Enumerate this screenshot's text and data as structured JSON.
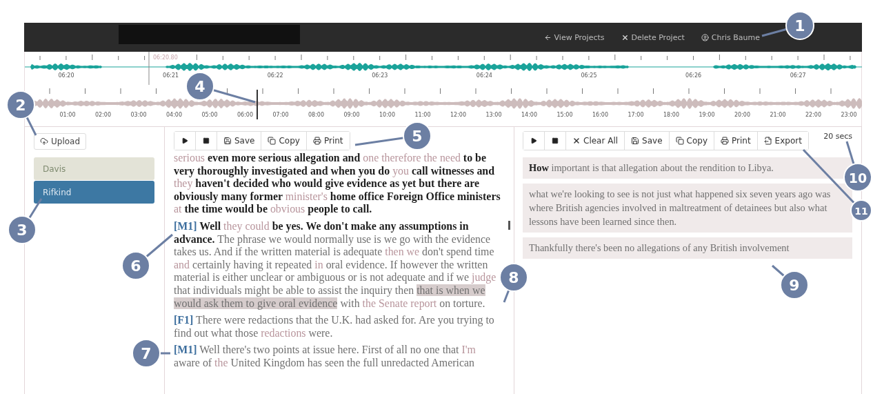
{
  "header": {
    "nav": [
      {
        "kind": "back",
        "label": "View Projects"
      },
      {
        "kind": "delete",
        "label": "Delete Project"
      },
      {
        "kind": "user",
        "label": "Chris Baume"
      }
    ]
  },
  "overview": {
    "cursor_time": "06:20.80",
    "ticks": [
      "06:20",
      "06:21",
      "06:22",
      "06:23",
      "06:24",
      "06:25",
      "06:26",
      "06:27"
    ]
  },
  "timeline": {
    "ticks": [
      "01:00",
      "02:00",
      "03:00",
      "04:00",
      "05:00",
      "06:00",
      "07:00",
      "08:00",
      "09:00",
      "10:00",
      "11:00",
      "12:00",
      "13:00",
      "14:00",
      "15:00",
      "16:00",
      "17:00",
      "18:00",
      "19:00",
      "20:00",
      "21:00",
      "22:00",
      "23:00"
    ]
  },
  "upload": {
    "label": "Upload"
  },
  "speakers": [
    {
      "name": "Davis",
      "selected": false
    },
    {
      "name": "Rifkind",
      "selected": true
    }
  ],
  "transcript": {
    "toolbar": [
      {
        "kind": "play"
      },
      {
        "kind": "stop"
      },
      {
        "kind": "save",
        "label": "Save"
      },
      {
        "kind": "copy",
        "label": "Copy"
      },
      {
        "kind": "print",
        "label": "Print"
      }
    ],
    "paragraphs": [
      {
        "segments": [
          {
            "kind": "faint",
            "text": "serious"
          },
          {
            "kind": "played",
            "text": " even more serious allegation and "
          },
          {
            "kind": "faint",
            "text": "one therefore the need"
          },
          {
            "kind": "played",
            "text": " to be very thoroughly investigated and when you do "
          },
          {
            "kind": "faint",
            "text": "you"
          },
          {
            "kind": "played",
            "text": " call witnesses and "
          },
          {
            "kind": "faint",
            "text": "they"
          },
          {
            "kind": "played",
            "text": " haven't decided who would give evidence as yet but there are obviously many former "
          },
          {
            "kind": "faint",
            "text": "minister's"
          },
          {
            "kind": "played",
            "text": " home office Foreign Office ministers "
          },
          {
            "kind": "faint",
            "text": "at"
          },
          {
            "kind": "played",
            "text": " the time would be "
          },
          {
            "kind": "faint",
            "text": "obvious"
          },
          {
            "kind": "played",
            "text": " people to call."
          }
        ]
      },
      {
        "speaker": "[M1]",
        "segments": [
          {
            "kind": "played",
            "text": " Well "
          },
          {
            "kind": "faint",
            "text": "they could"
          },
          {
            "kind": "played",
            "text": " be yes. We don't make any assumptions in advance."
          },
          {
            "kind": "unplayed",
            "text": " The phrase we would normally use is we go with the evidence takes us. And if the written material is adequate "
          },
          {
            "kind": "faint",
            "text": "then we"
          },
          {
            "kind": "unplayed",
            "text": " don't spend time "
          },
          {
            "kind": "faint",
            "text": "and"
          },
          {
            "kind": "unplayed",
            "text": " certainly having it repeated "
          },
          {
            "kind": "faint",
            "text": "in"
          },
          {
            "kind": "unplayed",
            "text": " oral evidence. If however the written material is either unclear or ambiguous or is not adequate and if we "
          },
          {
            "kind": "faint",
            "text": "judge"
          },
          {
            "kind": "unplayed",
            "text": " that individuals might be able to assist the inquiry then "
          },
          {
            "kind": "selected",
            "text": "that is when we would ask them to give oral evidence"
          },
          {
            "kind": "unplayed",
            "text": " with "
          },
          {
            "kind": "faint",
            "text": "the Senate report"
          },
          {
            "kind": "unplayed",
            "text": " on torture."
          }
        ]
      },
      {
        "speaker": "[F1]",
        "segments": [
          {
            "kind": "unplayed",
            "text": " There were redactions that the U.K. had asked for. Are you trying to find out what those "
          },
          {
            "kind": "faint",
            "text": "redactions"
          },
          {
            "kind": "unplayed",
            "text": " were."
          }
        ]
      },
      {
        "speaker": "[M1]",
        "segments": [
          {
            "kind": "unplayed",
            "text": " Well there's two points at issue here. First of all no one that "
          },
          {
            "kind": "faint",
            "text": "I'm"
          },
          {
            "kind": "unplayed",
            "text": " aware of "
          },
          {
            "kind": "faint",
            "text": "the"
          },
          {
            "kind": "unplayed",
            "text": " United Kingdom has seen the full unredacted American"
          }
        ]
      }
    ]
  },
  "clips": {
    "toolbar": [
      {
        "kind": "play"
      },
      {
        "kind": "stop"
      },
      {
        "kind": "clear",
        "label": "Clear All"
      },
      {
        "kind": "save",
        "label": "Save"
      },
      {
        "kind": "copy",
        "label": "Copy"
      },
      {
        "kind": "print",
        "label": "Print"
      },
      {
        "kind": "export",
        "label": "Export"
      }
    ],
    "duration": "20 secs",
    "items": [
      {
        "segments": [
          {
            "kind": "played",
            "text": "How"
          },
          {
            "kind": "unplayed",
            "text": " important is that allegation about the rendition to Libya."
          }
        ]
      },
      {
        "segments": [
          {
            "kind": "unplayed",
            "text": "what we're looking to see is not just what happened six seven years ago was where British agencies involved in maltreatment of detainees but also what lessons have been learned since then."
          }
        ]
      },
      {
        "segments": [
          {
            "kind": "unplayed",
            "text": "Thankfully there's been no allegations of any British involvement"
          }
        ]
      }
    ]
  },
  "callouts": [
    "1",
    "2",
    "3",
    "4",
    "5",
    "6",
    "7",
    "8",
    "9",
    "10",
    "11"
  ]
}
